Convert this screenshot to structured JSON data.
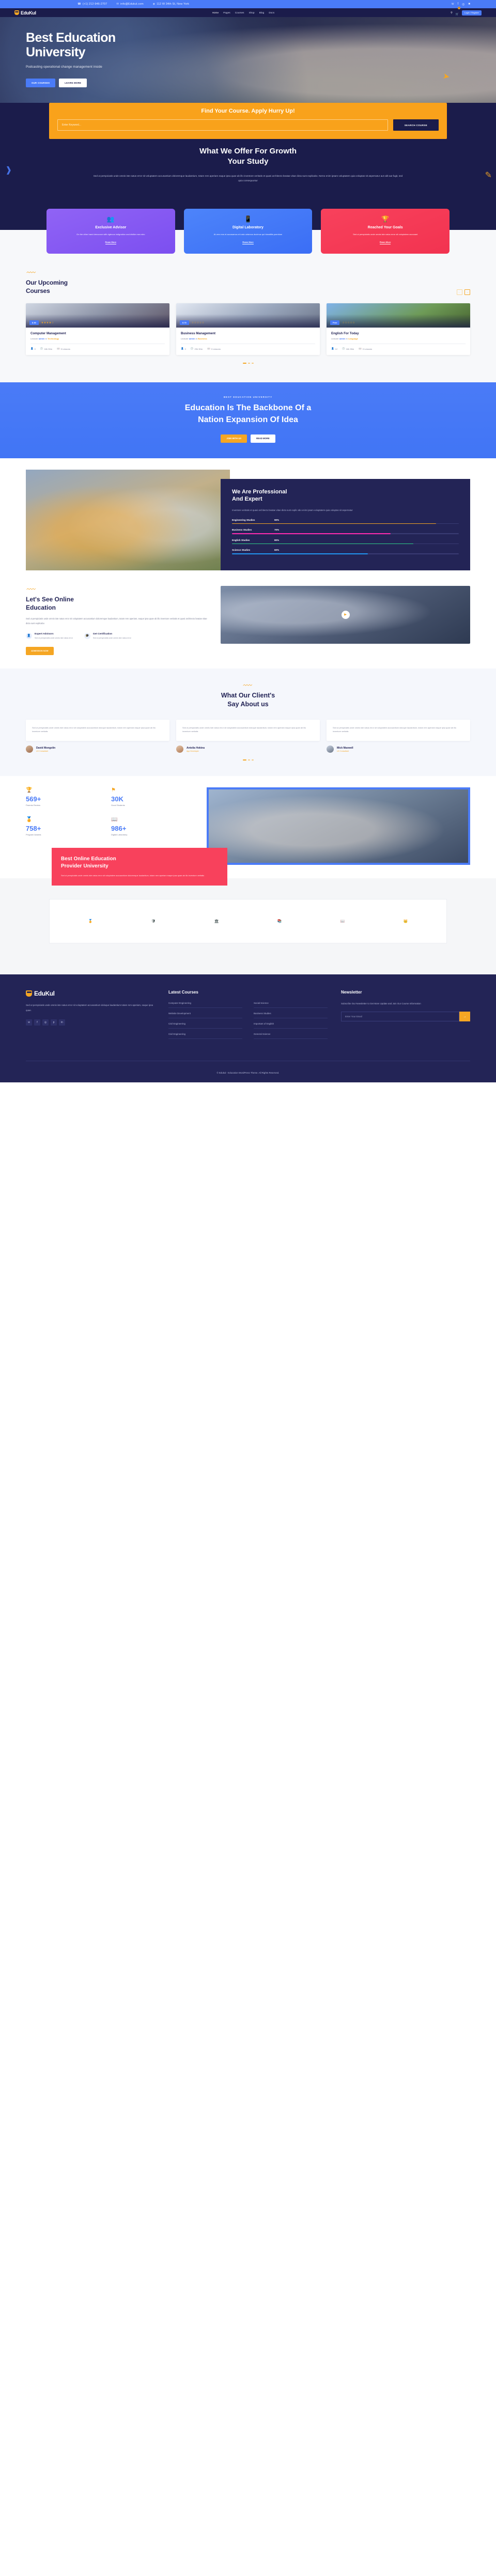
{
  "topbar": {
    "phone": "(+1) 212-946-2707",
    "email": "info@Edukul.com",
    "address": "112 W 34th St, New York",
    "socials": [
      "twitter-icon",
      "facebook-icon",
      "instagram-icon",
      "linkedin-icon"
    ]
  },
  "nav": {
    "brand": "EduKul",
    "items": [
      {
        "label": "Home",
        "caret": true,
        "active": true
      },
      {
        "label": "Pages",
        "caret": true,
        "active": false
      },
      {
        "label": "Courses",
        "caret": true,
        "active": false
      },
      {
        "label": "Shop",
        "caret": false,
        "active": false
      },
      {
        "label": "Blog",
        "caret": false,
        "active": false
      },
      {
        "label": "Docs",
        "caret": false,
        "active": false
      }
    ],
    "cart_count": "0",
    "login_label": "Login / Register"
  },
  "hero": {
    "title_line1": "Best Education",
    "title_line2": "University",
    "subtitle": "Podcasting operational change management inside",
    "btn_primary": "OUR COURSES",
    "btn_secondary": "LEARN MORE"
  },
  "search": {
    "heading": "Find Your Course. Apply Hurry Up!",
    "placeholder": "Enter Keyword...",
    "button": "SEARCH COURSE"
  },
  "offer": {
    "title_line1": "What We Offer For Growth",
    "title_line2": "Your Study",
    "description": "Sed ut perspiciatis unde omnis iste natus error sit voluptatem accusantium doloremque laudantium, totam rem aperiam eaque ipsa quae ab illo inventore veritatis et quasi architecto beatae vitae dicta sunt explicabo. Nemo enim ipsam voluptatem quia voluptas sit aspernatur aut odit aut fugit, sed quia consequuntur",
    "cards": [
      {
        "icon": "users-icon",
        "title": "Exclusive Advisor",
        "text": "On the other hand denounce with rigteous indignation and dislike men who",
        "link": "Ream More",
        "color": "#7c4ff0"
      },
      {
        "icon": "code-device-icon",
        "title": "Digital Laboratory",
        "text": "At vero eos et accusamus et iusto odsimos ducimus qui blanditiis psentium",
        "link": "Ream More",
        "color": "#3b6ef5"
      },
      {
        "icon": "trophy-icon",
        "title": "Reached Your Goals",
        "text": "Sed ut perspiciatis unde omnis iste natus error sit voluptatem accusant",
        "link": "Ream More",
        "color": "#f23350"
      }
    ]
  },
  "courses": {
    "title_line1": "Our Upcoming",
    "title_line2": "Courses",
    "prev": "←",
    "next": "→",
    "items": [
      {
        "price": "$ 30",
        "stars": "★★★★☆",
        "title": "Computer Management",
        "lecturer_prefix": "Lecturer",
        "lecturer": "admin",
        "in": "in",
        "category": "Technology",
        "students": "0",
        "duration": "18h 30m",
        "lessons": "5 Lessons"
      },
      {
        "price": "$ 70",
        "stars": "☆☆☆☆☆",
        "title": "Business Management",
        "lecturer_prefix": "Lecturer",
        "lecturer": "admin",
        "in": "in",
        "category": "Business",
        "students": "0",
        "duration": "23h 30m",
        "lessons": "0 Lessons"
      },
      {
        "price": "Free",
        "stars": "☆☆☆☆☆",
        "title": "English For Today",
        "lecturer_prefix": "Lecturer",
        "lecturer": "admin",
        "in": "in",
        "category": "Language",
        "students": "12",
        "duration": "16h 30m",
        "lessons": "0 Lessons"
      }
    ]
  },
  "bluecta": {
    "kicker": "BEST EDUCATION UNIVERSITY",
    "title_line1": "Education Is The Backbone Of a",
    "title_line2": "Nation Expansion Of Idea",
    "btn_primary": "JOIN WITH US",
    "btn_secondary": "READ MORE"
  },
  "professional": {
    "title_line1": "We Are Professional",
    "title_line2": "And Expert",
    "description": "Inventore veritatis et quasi architecto beatae vitae dicta sunt explic abo enim ipsam voluptatem quia voluptas sit aspernatur",
    "bars": [
      {
        "label": "Engineering Studies",
        "value": "90%",
        "pct": 90,
        "color": "#f5a623"
      },
      {
        "label": "Business Studies",
        "value": "70%",
        "pct": 70,
        "color": "#ff2bb0"
      },
      {
        "label": "English Studies",
        "value": "80%",
        "pct": 80,
        "color": "#2fd08a"
      },
      {
        "label": "Science Studies",
        "value": "60%",
        "pct": 60,
        "color": "#2196f3"
      }
    ]
  },
  "online": {
    "title_line1": "Let's See Online",
    "title_line2": "Education",
    "description": "Sed ut perspiciatis unde omnis iste natus error sit voluptatem accusantium doloremque laudantium, totam rem aperiam, eaque ipsa quae ab illo inventore veritatis et quasi architecto beatae vitae dicta sunt explicabo",
    "features": [
      {
        "icon": "user-expert-icon",
        "title": "Expert Advisors",
        "text": "Sed ut perspiciatis unde omnis iste natus error"
      },
      {
        "icon": "certificate-icon",
        "title": "Get Certification",
        "text": "Sed ut perspiciatis unde omnis iste natus error"
      }
    ],
    "button": "ADMISSION NOW",
    "play_icon": "play-icon"
  },
  "testimonials": {
    "title_line1": "What Our Client's",
    "title_line2": "Say About us",
    "quotes": [
      "Sed ut perspiciatis unde omnis iste natus error sit voluptatem accusantium doloque laudantium, totam rem aperiam eaque ipsa quae ab illo inventore veritatis",
      "Sed ut perspiciatis unde omnis iste natus error sit voluptatem accusantium doloque laudantium, totam rem aperiam eaque ipsa quae ab illo inventore veritatis",
      "Sed ut perspiciatis unde omnis iste natus error sit voluptatem accusantium doloque laudantium, totam rem aperiam eaque ipsa quae ab illo inventore veritatis"
    ],
    "people": [
      {
        "name": "David Mongolin",
        "role": "UX Consultant"
      },
      {
        "name": "Antolia Hokina",
        "role": "App Developer"
      },
      {
        "name": "Mick Maxwell",
        "role": "UX Consultant"
      }
    ]
  },
  "stats": {
    "items": [
      {
        "icon": "trophy-icon",
        "number": "569+",
        "label": "Parents Review"
      },
      {
        "icon": "flag-icon",
        "number": "30K",
        "label": "Good Students"
      },
      {
        "icon": "medal-icon",
        "number": "758+",
        "label": "Program Awards"
      },
      {
        "icon": "book-icon",
        "number": "986+",
        "label": "Digital Laboratory"
      }
    ],
    "promo_title_line1": "Best Online Education",
    "promo_title_line2": "Provider University",
    "promo_text": "Sed ut perspiciatis unde omnis iste natus error sit voluptatem accusantium doloremque laudantium, totam rem aperiam eaque ipsa quae ab illo inventore veritatis"
  },
  "partners": {
    "logos": [
      "university-badge-icon",
      "university-shield-icon",
      "college-1820-icon",
      "university-academic-icon",
      "college-campus-icon",
      "university-crown-icon"
    ]
  },
  "footer": {
    "brand": "EduKul",
    "about": "Sed ut perspiciatis unde omnis iste natus error sit voluptatem accusantium doloque laudantium totam rem aperiam, eaque ipsa quae.",
    "socials": [
      "twitter-icon",
      "facebook-icon",
      "instagram-icon",
      "pinterest-icon",
      "linkedin-icon"
    ],
    "courses_heading": "Latest Courses",
    "courses_col1": [
      "Computer Engineering",
      "Website Development",
      "Civil Engineering",
      "Civil Engineering"
    ],
    "courses_col2": [
      "Social Science",
      "Business Studies",
      "Important of English",
      "General Science"
    ],
    "newsletter_heading": "Newsletter",
    "newsletter_text": "Subscribe Our Newsletter to Get More Update and Join Our Course Information",
    "newsletter_placeholder": "Enter Your Email",
    "newsletter_button": "→",
    "copyright": "© Edukul - Education WordPress Theme. All Rights Reserved."
  }
}
